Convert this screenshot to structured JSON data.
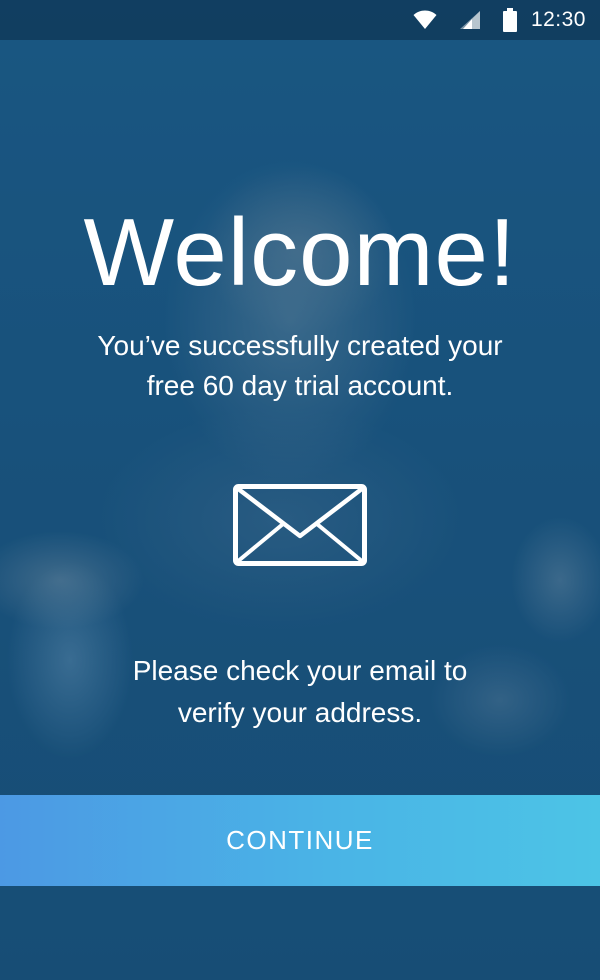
{
  "status_bar": {
    "time": "12:30",
    "icons": [
      "wifi-icon",
      "cellular-signal-icon",
      "battery-icon"
    ]
  },
  "welcome": {
    "title": "Welcome!",
    "subtitle_line1": "You’ve successfully created your",
    "subtitle_line2": "free 60 day trial account."
  },
  "email_notice": {
    "icon": "envelope-icon",
    "line1": "Please check your email to",
    "line2": "verify your address."
  },
  "actions": {
    "continue_label": "CONTINUE"
  },
  "colors": {
    "background": "#1c5680",
    "button_gradient_start": "#4c99e4",
    "button_gradient_end": "#4cc4e6",
    "text": "#ffffff"
  }
}
